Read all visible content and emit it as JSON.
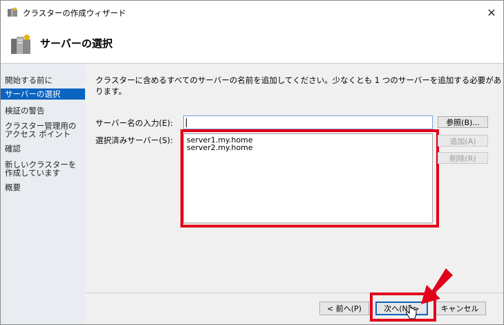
{
  "window": {
    "title": "クラスターの作成ウィザード",
    "header_title": "サーバーの選択",
    "close_glyph": "✕"
  },
  "nav": {
    "items": [
      {
        "label": "開始する前に",
        "selected": false
      },
      {
        "label": "サーバーの選択",
        "selected": true
      },
      {
        "label": "検証の警告",
        "selected": false
      },
      {
        "label": "クラスター管理用のアクセス ポイント",
        "selected": false
      },
      {
        "label": "確認",
        "selected": false
      },
      {
        "label": "新しいクラスターを作成しています",
        "selected": false
      },
      {
        "label": "概要",
        "selected": false
      }
    ]
  },
  "main": {
    "instruction": "クラスターに含めるすべてのサーバーの名前を追加してください。少なくとも 1 つのサーバーを追加する必要があります。",
    "server_name_label": "サーバー名の入力(E):",
    "server_name_value": "",
    "selected_servers_label": "選択済みサーバー(S):",
    "selected_servers": [
      "server1.my.home",
      "server2.my.home"
    ],
    "browse_button": "参照(B)...",
    "add_button": "追加(A)",
    "remove_button": "削除(R)"
  },
  "footer": {
    "prev_button": "< 前へ(P)",
    "next_button": "次へ(N) >",
    "cancel_button": "キャンセル"
  },
  "colors": {
    "highlight_red": "#e2001a",
    "selection_blue": "#0b64c0",
    "nav_bg": "#e9ecf1",
    "content_bg": "#f0f0f0"
  }
}
